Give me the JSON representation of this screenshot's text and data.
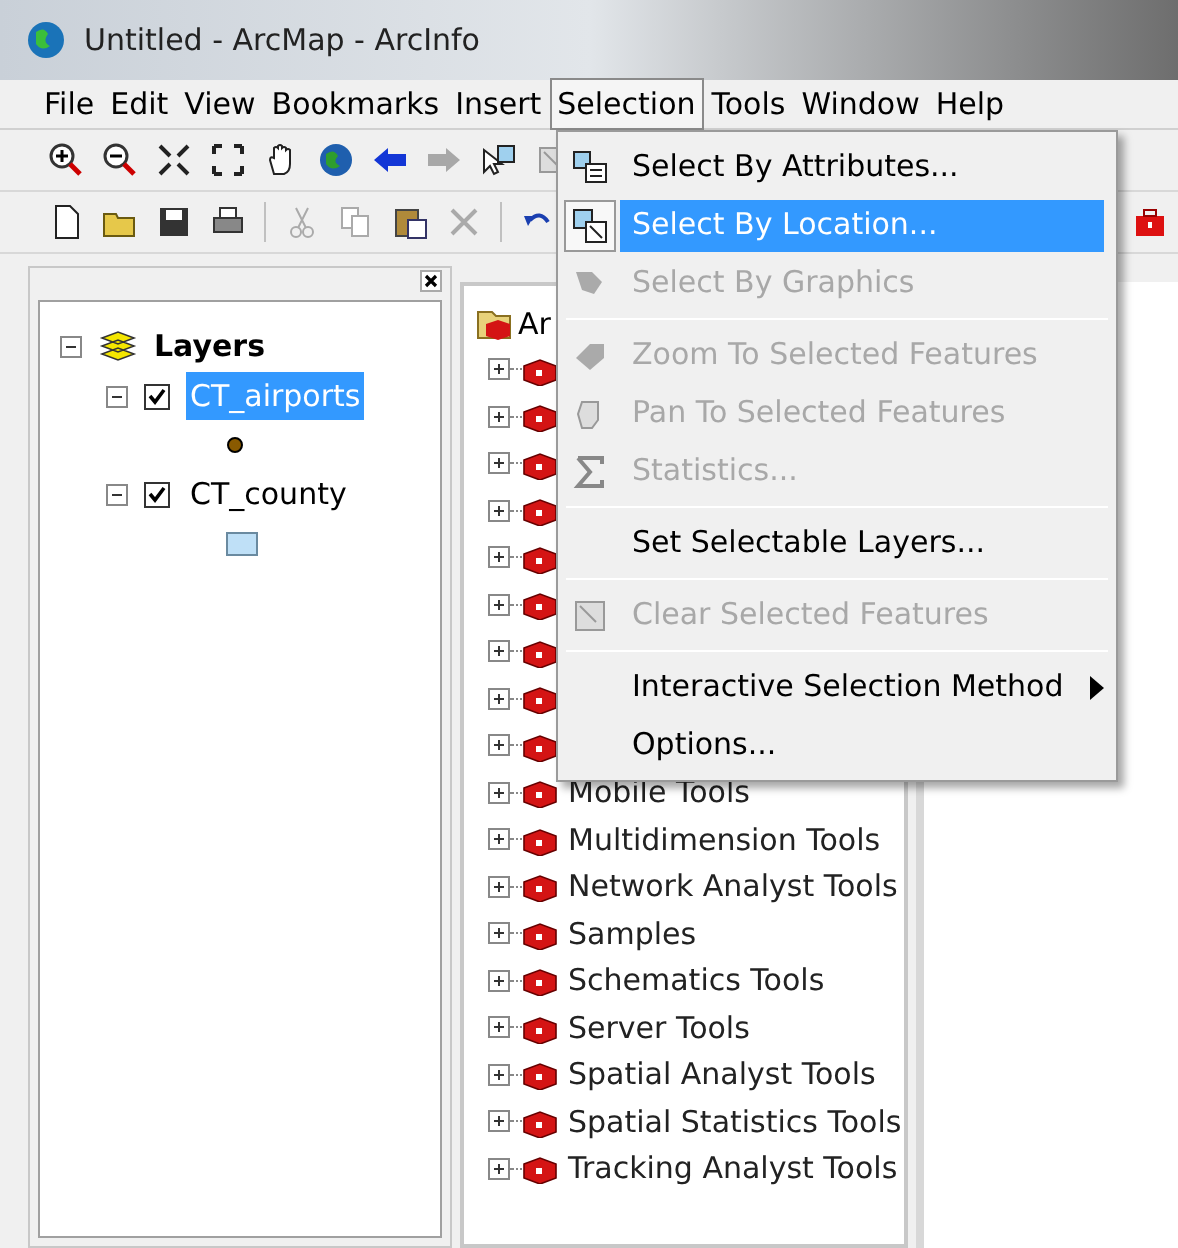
{
  "window": {
    "title": "Untitled - ArcMap - ArcInfo"
  },
  "menu_bar": [
    {
      "label": "File",
      "selected": false
    },
    {
      "label": "Edit",
      "selected": false
    },
    {
      "label": "View",
      "selected": false
    },
    {
      "label": "Bookmarks",
      "selected": false
    },
    {
      "label": "Insert",
      "selected": false
    },
    {
      "label": "Selection",
      "selected": true
    },
    {
      "label": "Tools",
      "selected": false
    },
    {
      "label": "Window",
      "selected": false
    },
    {
      "label": "Help",
      "selected": false
    }
  ],
  "selection_menu": [
    {
      "kind": "item",
      "label": "Select By Attributes...",
      "disabled": false,
      "selected": false
    },
    {
      "kind": "item",
      "label": "Select By Location...",
      "disabled": false,
      "selected": true
    },
    {
      "kind": "item",
      "label": "Select By Graphics",
      "disabled": true,
      "selected": false
    },
    {
      "kind": "separator"
    },
    {
      "kind": "item",
      "label": "Zoom To Selected Features",
      "disabled": true,
      "selected": false
    },
    {
      "kind": "item",
      "label": "Pan To Selected Features",
      "disabled": true,
      "selected": false
    },
    {
      "kind": "item",
      "label": "Statistics...",
      "disabled": true,
      "selected": false
    },
    {
      "kind": "separator"
    },
    {
      "kind": "item",
      "label": "Set Selectable Layers...",
      "disabled": false,
      "selected": false
    },
    {
      "kind": "separator"
    },
    {
      "kind": "item",
      "label": "Clear Selected Features",
      "disabled": true,
      "selected": false
    },
    {
      "kind": "separator"
    },
    {
      "kind": "submenu",
      "label": "Interactive Selection Method",
      "disabled": false,
      "selected": false
    },
    {
      "kind": "item",
      "label": "Options...",
      "disabled": false,
      "selected": false
    }
  ],
  "table_of_contents": {
    "title": "Layers",
    "layers": [
      {
        "name": "CT_airports",
        "checked": true,
        "selected": true,
        "kind": "point"
      },
      {
        "name": "CT_county",
        "checked": true,
        "selected": false,
        "kind": "polygon"
      }
    ]
  },
  "catalog": {
    "header": "Ar",
    "items": [
      {
        "kind": "covered"
      },
      {
        "kind": "covered"
      },
      {
        "kind": "covered"
      },
      {
        "kind": "covered"
      },
      {
        "kind": "covered"
      },
      {
        "kind": "covered"
      },
      {
        "kind": "covered"
      },
      {
        "kind": "covered"
      },
      {
        "kind": "covered"
      },
      {
        "kind": "toolbox",
        "label": "Mobile Tools"
      },
      {
        "kind": "toolbox",
        "label": "Multidimension Tools"
      },
      {
        "kind": "toolbox",
        "label": "Network Analyst Tools"
      },
      {
        "kind": "toolbox",
        "label": "Samples"
      },
      {
        "kind": "toolbox",
        "label": "Schematics Tools"
      },
      {
        "kind": "toolbox",
        "label": "Server Tools"
      },
      {
        "kind": "toolbox",
        "label": "Spatial Analyst Tools"
      },
      {
        "kind": "toolbox",
        "label": "Spatial Statistics Tools"
      },
      {
        "kind": "toolbox",
        "label": "Tracking Analyst Tools"
      }
    ]
  }
}
